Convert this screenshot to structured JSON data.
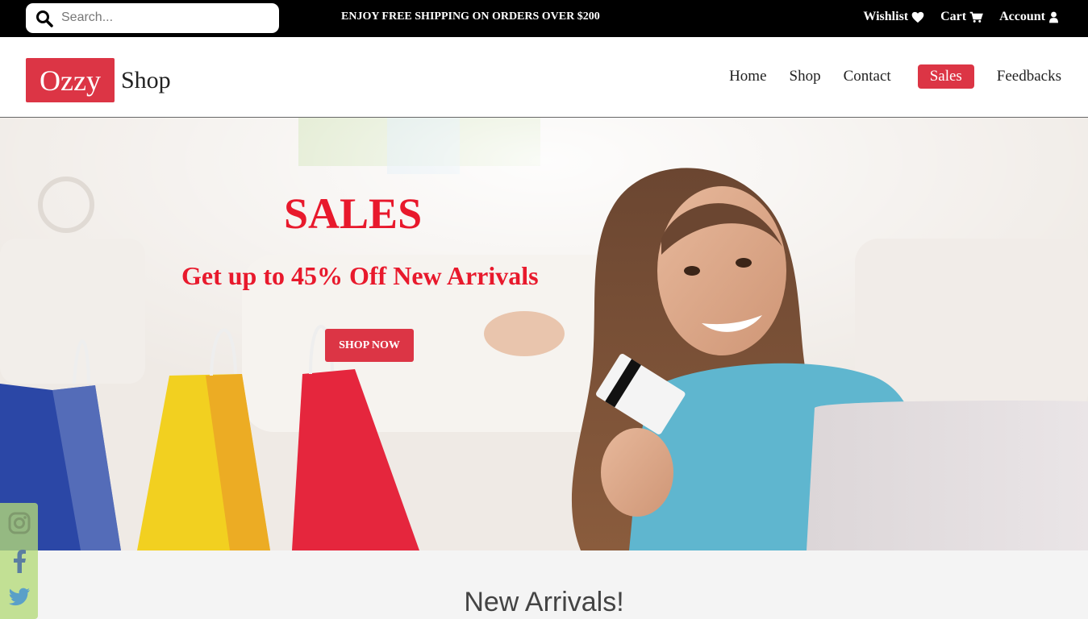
{
  "topbar": {
    "search_placeholder": "Search...",
    "promo": "ENJOY FREE SHIPPING ON ORDERS OVER $200",
    "links": [
      {
        "label": "Wishlist",
        "icon": "heart-icon"
      },
      {
        "label": "Cart",
        "icon": "cart-icon"
      },
      {
        "label": "Account",
        "icon": "user-icon"
      }
    ]
  },
  "header": {
    "logo_box": "Ozzy",
    "logo_text": "Shop",
    "nav": [
      "Home",
      "Shop",
      "Contact",
      "Sales",
      "Feedbacks"
    ],
    "active_nav": "Sales"
  },
  "hero": {
    "title": "SALES",
    "subtitle": "Get up to 45% Off New Arrivals",
    "button": "SHOP NOW"
  },
  "social": [
    "instagram-icon",
    "facebook-icon",
    "twitter-icon"
  ],
  "section": {
    "title": "New Arrivals!"
  },
  "colors": {
    "accent": "#dc3545",
    "hero_text": "#e8192c",
    "topbar": "#000000",
    "social_bg": "#b4da78"
  }
}
